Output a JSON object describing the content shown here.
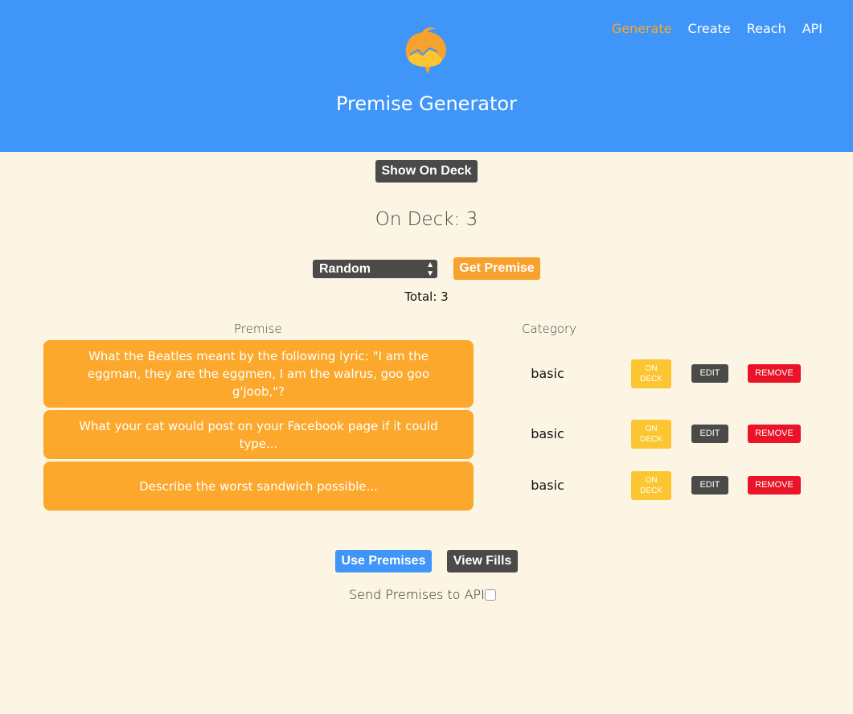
{
  "nav": {
    "items": [
      {
        "label": "Generate",
        "active": true
      },
      {
        "label": "Create",
        "active": false
      },
      {
        "label": "Reach",
        "active": false
      },
      {
        "label": "API",
        "active": false
      }
    ]
  },
  "header": {
    "title": "Premise Generator",
    "logo_icon": "speech-bubble-logo-icon"
  },
  "controls": {
    "show_on_deck_label": "Show On Deck",
    "on_deck_title": "On Deck: 3",
    "category_select_value": "Random",
    "get_premise_label": "Get Premise",
    "total_text": "Total: 3"
  },
  "table": {
    "headers": {
      "premise": "Premise",
      "category": "Category"
    },
    "rows": [
      {
        "premise": "What the Beatles meant by the following lyric: \"I am the eggman, they are the eggmen, I am the walrus, goo goo g'joob,\"?",
        "category": "basic",
        "on_deck_line1": "ON",
        "on_deck_line2": "DECK",
        "edit_label": "EDIT",
        "remove_label": "REMOVE"
      },
      {
        "premise": "What your cat would post on your Facebook page if it could type...",
        "category": "basic",
        "on_deck_line1": "ON",
        "on_deck_line2": "DECK",
        "edit_label": "EDIT",
        "remove_label": "REMOVE"
      },
      {
        "premise": "Describe the worst sandwich possible...",
        "category": "basic",
        "on_deck_line1": "ON",
        "on_deck_line2": "DECK",
        "edit_label": "EDIT",
        "remove_label": "REMOVE"
      }
    ]
  },
  "footer": {
    "use_premises_label": "Use Premises",
    "view_fills_label": "View Fills",
    "send_api_label": "Send Premises to API?",
    "send_api_checked": false
  },
  "colors": {
    "header_bg": "#4095f8",
    "page_bg": "#fdf5e4",
    "accent_orange": "#fca82c",
    "on_deck_yellow": "#fcc532",
    "remove_red": "#ea1328",
    "dark_button": "#4a4a48"
  }
}
